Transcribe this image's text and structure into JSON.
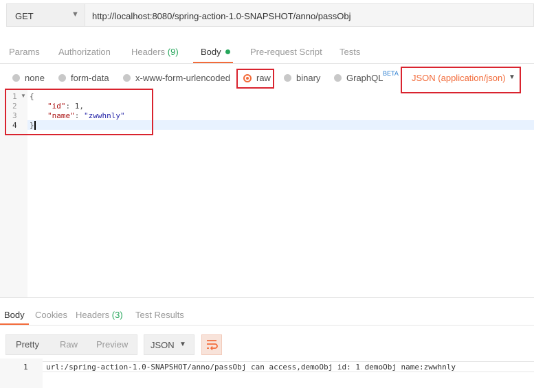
{
  "request": {
    "method": "GET",
    "url": "http://localhost:8080/spring-action-1.0-SNAPSHOT/anno/passObj"
  },
  "tabs": {
    "params": "Params",
    "authorization": "Authorization",
    "headers": "Headers",
    "headers_count": "(9)",
    "body": "Body",
    "prerequest": "Pre-request Script",
    "tests": "Tests"
  },
  "body_types": {
    "none": "none",
    "form_data": "form-data",
    "urlencoded": "x-www-form-urlencoded",
    "raw": "raw",
    "binary": "binary",
    "graphql": "GraphQL",
    "beta": "BETA",
    "selected": "raw",
    "content_type": "JSON (application/json)"
  },
  "editor": {
    "line_numbers": [
      "1",
      "2",
      "3",
      "4"
    ],
    "open_brace": "{",
    "id_key": "\"id\"",
    "id_value": "1",
    "name_key": "\"name\"",
    "name_value": "\"zwwhnly\"",
    "close_brace": "}"
  },
  "response": {
    "tabs": {
      "body": "Body",
      "cookies": "Cookies",
      "headers": "Headers",
      "headers_count": "(3)",
      "test_results": "Test Results"
    },
    "views": {
      "pretty": "Pretty",
      "raw": "Raw",
      "preview": "Preview"
    },
    "format": "JSON",
    "line_number": "1",
    "text": "url:/spring-action-1.0-SNAPSHOT/anno/passObj can access,demoObj id: 1 demoObj name:zwwhnly"
  },
  "colors": {
    "accent": "#f26b3a",
    "count": "#26a65b",
    "highlight_box": "#d9232e",
    "beta": "#2f80d1"
  }
}
